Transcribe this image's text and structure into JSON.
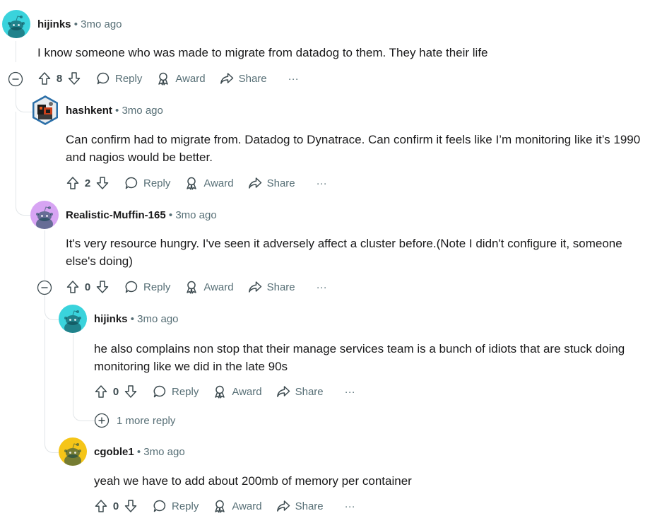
{
  "colors": {
    "text": "#1a1a1b",
    "muted": "#576f76",
    "thread_line": "#e1e5e8",
    "avatar_cyan": "#3ad3dc",
    "avatar_purple": "#d7a4f3",
    "avatar_yellow": "#f5c518",
    "avatar_hex": "#2b6fa8"
  },
  "labels": {
    "reply": "Reply",
    "award": "Award",
    "share": "Share",
    "more": "···",
    "dot": "•"
  },
  "comments": [
    {
      "user": "hijinks",
      "time": "3mo ago",
      "avatar": "snoo-cyan",
      "score": "8",
      "body": "I know someone who was made to migrate from datadog to them. They hate their life"
    },
    {
      "user": "hashkent",
      "time": "3mo ago",
      "avatar": "hexagon-custom",
      "score": "2",
      "body": "Can confirm had to migrate from. Datadog to Dynatrace. Can confirm it feels like I’m monitoring like it’s 1990 and nagios would be better."
    },
    {
      "user": "Realistic-Muffin-165",
      "time": "3mo ago",
      "avatar": "snoo-purple",
      "score": "0",
      "body": "It's very resource hungry. I've seen it adversely affect a cluster before.(Note I didn't configure it, someone else's doing)"
    },
    {
      "user": "hijinks",
      "time": "3mo ago",
      "avatar": "snoo-cyan",
      "score": "0",
      "body": "he also complains non stop that their manage services team is a bunch of idiots that are stuck doing monitoring like we did in the late 90s"
    },
    {
      "user": "cgoble1",
      "time": "3mo ago",
      "avatar": "snoo-yellow",
      "score": "0",
      "body": "yeah we have to add about 200mb of memory per container"
    }
  ],
  "more_replies": "1 more reply"
}
